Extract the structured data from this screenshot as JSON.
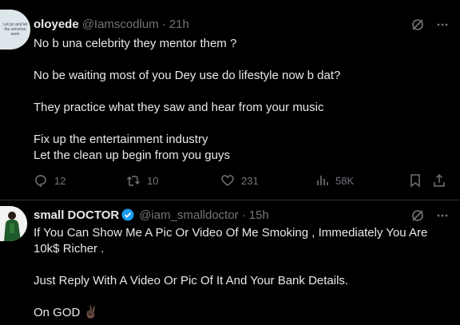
{
  "tweet1": {
    "avatar_text": "Let go and let the universe work",
    "name": "oloyede",
    "handle": "@Iamscodlum",
    "separator": "·",
    "time": "21h",
    "lines": [
      "No b una celebrity they mentor them ?",
      "No be waiting most of you Dey use do lifestyle now b dat?",
      "They practice what they saw and hear from your music",
      "Fix up the entertainment industry",
      "Let the clean up begin from you guys"
    ],
    "replies": "12",
    "reposts": "10",
    "likes": "231",
    "views": "58K"
  },
  "tweet2": {
    "name": "small DOCTOR",
    "handle": "@iam_smalldoctor",
    "separator": "·",
    "time": "15h",
    "lines": [
      "If You Can Show Me A Pic Or Video Of Me Smoking , Immediately You Are",
      "10k$ Richer .",
      "Just Reply With A Video Or Pic Of It And Your Bank Details.",
      "On GOD ✌🏿"
    ]
  },
  "colors": {
    "accent": "#1d9bf0",
    "muted": "#71767b",
    "text": "#e7e9ea",
    "divider": "#2f3336"
  },
  "icons": [
    "grok-icon",
    "more-icon",
    "reply-icon",
    "repost-icon",
    "like-icon",
    "views-icon",
    "bookmark-icon",
    "share-icon",
    "verified-badge-icon"
  ]
}
